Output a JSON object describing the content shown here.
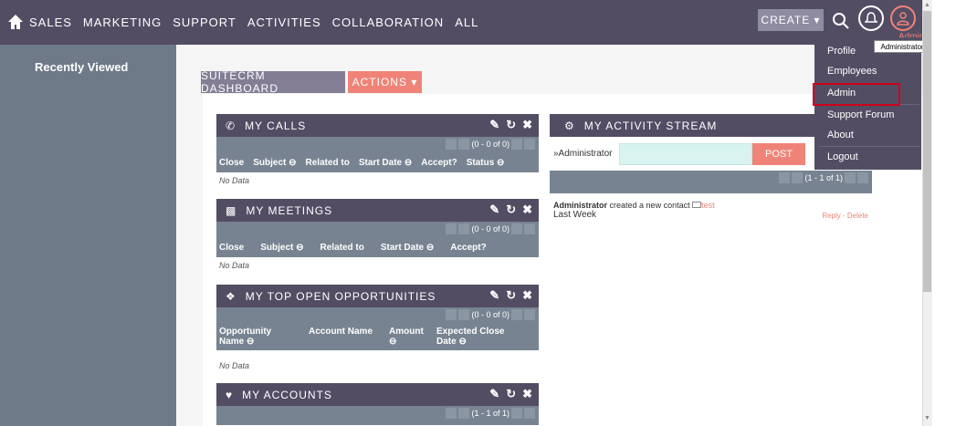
{
  "topnav": {
    "links": [
      "SALES",
      "MARKETING",
      "SUPPORT",
      "ACTIVITIES",
      "COLLABORATION",
      "ALL"
    ],
    "create_label": "CREATE ▾",
    "user_label": "Administ"
  },
  "sidebar": {
    "title": "Recently Viewed",
    "collapse_glyph": "◁"
  },
  "tabs": {
    "dashboard": "SUITECRM DASHBOARD",
    "actions": "ACTIONS ▾"
  },
  "dashlets": {
    "calls": {
      "title": "MY CALLS",
      "pager": "(0 - 0 of 0)",
      "columns": [
        "Close",
        "Subject ⊖",
        "Related to",
        "Start Date ⊖",
        "Accept?",
        "Status ⊖"
      ],
      "empty": "No Data"
    },
    "meetings": {
      "title": "MY MEETINGS",
      "pager": "(0 - 0 of 0)",
      "columns": [
        "Close",
        "Subject ⊖",
        "Related to",
        "Start Date ⊖",
        "Accept?"
      ],
      "empty": "No Data"
    },
    "opportunities": {
      "title": "MY TOP OPEN OPPORTUNITIES",
      "pager": "(0 - 0 of 0)",
      "columns": [
        "Opportunity Name ⊖",
        "Account Name",
        "Amount ⊖",
        "Expected Close Date ⊖"
      ],
      "empty": "No Data"
    },
    "accounts": {
      "title": "MY ACCOUNTS",
      "pager": "(1 - 1 of 1)"
    }
  },
  "stream": {
    "title": "MY ACTIVITY STREAM",
    "user": "»Administrator",
    "post": "POST",
    "pager": "(1 - 1 of 1)",
    "entry_user": "Administrator",
    "entry_text": "created a new contact",
    "entry_link": "test",
    "entry_time": "Last Week",
    "reply": "Reply - Delete"
  },
  "dropdown": {
    "items": [
      "Profile",
      "Employees",
      "Admin",
      "Support Forum",
      "About",
      "Logout"
    ],
    "tooltip": "Administrator"
  },
  "colors": {
    "nav": "#534d64",
    "accent": "#f08377",
    "sidebar": "#6f7a88"
  }
}
